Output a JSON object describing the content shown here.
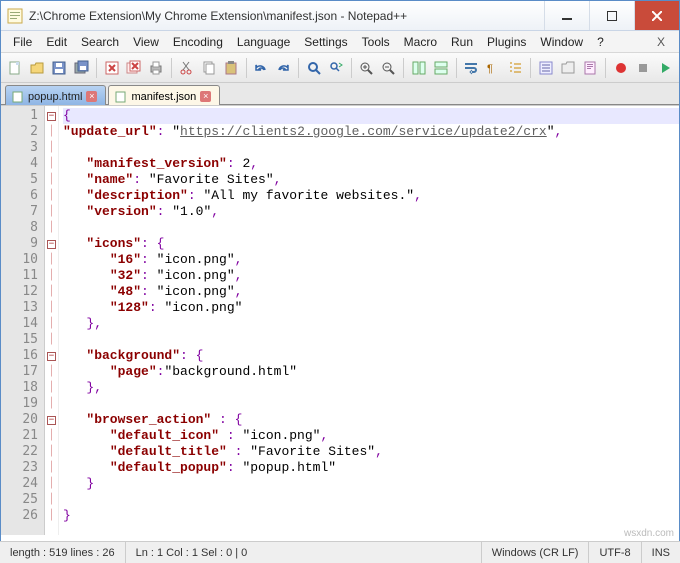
{
  "window": {
    "title": "Z:\\Chrome Extension\\My Chrome Extension\\manifest.json - Notepad++"
  },
  "menu": {
    "file": "File",
    "edit": "Edit",
    "search": "Search",
    "view": "View",
    "encoding": "Encoding",
    "language": "Language",
    "settings": "Settings",
    "tools": "Tools",
    "macro": "Macro",
    "run": "Run",
    "plugins": "Plugins",
    "window": "Window",
    "help": "?",
    "x": "X"
  },
  "tabs": {
    "inactive": "popup.html",
    "active": "manifest.json"
  },
  "code": {
    "l1": "{",
    "l2": "\"update_url\": \"https://clients2.google.com/service/update2/crx\",",
    "l3": "",
    "l4": "   \"manifest_version\": 2,",
    "l5": "   \"name\": \"Favorite Sites\",",
    "l6": "   \"description\": \"All my favorite websites.\",",
    "l7": "   \"version\": \"1.0\",",
    "l8": "",
    "l9": "   \"icons\": {",
    "l10": "      \"16\": \"icon.png\",",
    "l11": "      \"32\": \"icon.png\",",
    "l12": "      \"48\": \"icon.png\",",
    "l13": "      \"128\": \"icon.png\"",
    "l14": "   },",
    "l15": "",
    "l16": "   \"background\": {",
    "l17": "      \"page\":\"background.html\"",
    "l18": "   },",
    "l19": "",
    "l20": "   \"browser_action\" : {",
    "l21": "      \"default_icon\" : \"icon.png\",",
    "l22": "      \"default_title\" : \"Favorite Sites\",",
    "l23": "      \"default_popup\": \"popup.html\"",
    "l24": "   }",
    "l25": "",
    "l26": "}"
  },
  "status": {
    "lenlines": "length : 519    lines : 26",
    "pos": "Ln : 1    Col : 1    Sel : 0 | 0",
    "eol": "Windows (CR LF)",
    "enc": "UTF-8",
    "mode": "INS"
  },
  "watermark": "wsxdn.com"
}
